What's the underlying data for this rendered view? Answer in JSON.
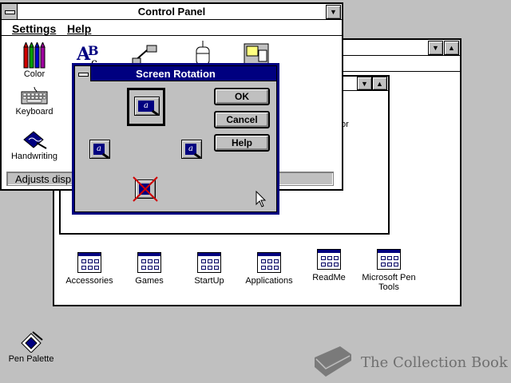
{
  "desktop": {
    "pen_palette_label": "Pen Palette",
    "watermark": "The Collection Book"
  },
  "control_panel": {
    "title": "Control Panel",
    "menu": {
      "settings": "Settings",
      "help": "Help"
    },
    "icons": [
      {
        "label": "Color",
        "icon": "color-icon"
      },
      {
        "label": "Keyboard",
        "icon": "keyboard-icon"
      },
      {
        "label": "Handwriting",
        "icon": "handwriting-icon"
      }
    ],
    "status_text": "Adjusts disp",
    "partial_label": "tor"
  },
  "program_manager": {
    "groups": [
      {
        "label": "Accessories"
      },
      {
        "label": "Games"
      },
      {
        "label": "StartUp"
      },
      {
        "label": "Applications"
      },
      {
        "label": "ReadMe"
      },
      {
        "label": "Microsoft Pen Tools"
      }
    ]
  },
  "dialog": {
    "title": "Screen Rotation",
    "ok": "OK",
    "cancel": "Cancel",
    "help": "Help",
    "glyph": "a"
  }
}
